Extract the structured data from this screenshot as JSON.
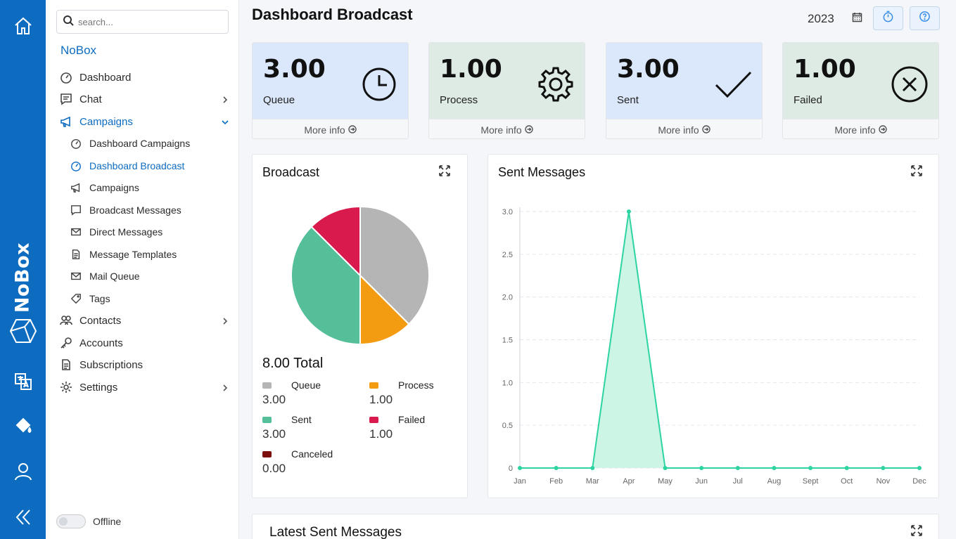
{
  "rail": {
    "brand": "NoBox",
    "icons": [
      "home-icon",
      "nobox-logo-icon",
      "translate-icon",
      "paint-bucket-icon",
      "user-icon",
      "collapse-icon"
    ]
  },
  "sidebar": {
    "search_placeholder": "search...",
    "brand": "NoBox",
    "items": [
      {
        "label": "Dashboard",
        "icon": "gauge-icon"
      },
      {
        "label": "Chat",
        "icon": "chat-icon"
      },
      {
        "label": "Campaigns",
        "icon": "megaphone-icon"
      },
      {
        "label": "Dashboard Campaigns",
        "icon": "gauge-icon"
      },
      {
        "label": "Dashboard Broadcast",
        "icon": "gauge-icon"
      },
      {
        "label": "Campaigns",
        "icon": "megaphone-icon"
      },
      {
        "label": "Broadcast Messages",
        "icon": "message-icon"
      },
      {
        "label": "Direct Messages",
        "icon": "mail-icon"
      },
      {
        "label": "Message Templates",
        "icon": "document-icon"
      },
      {
        "label": "Mail Queue",
        "icon": "mail-icon"
      },
      {
        "label": "Tags",
        "icon": "tag-icon"
      },
      {
        "label": "Contacts",
        "icon": "users-icon"
      },
      {
        "label": "Accounts",
        "icon": "key-icon"
      },
      {
        "label": "Subscriptions",
        "icon": "document-icon"
      },
      {
        "label": "Settings",
        "icon": "gear-icon"
      }
    ],
    "offline_label": "Offline"
  },
  "header": {
    "title": "Dashboard Broadcast",
    "year": "2023"
  },
  "cards": [
    {
      "value": "3.00",
      "label": "Queue",
      "more": "More info",
      "color": "#dbe8fb",
      "icon": "clock-icon"
    },
    {
      "value": "1.00",
      "label": "Process",
      "more": "More info",
      "color": "#deebe4",
      "icon": "gear-icon"
    },
    {
      "value": "3.00",
      "label": "Sent",
      "more": "More info",
      "color": "#dbe8fb",
      "icon": "check-icon"
    },
    {
      "value": "1.00",
      "label": "Failed",
      "more": "More info",
      "color": "#deebe4",
      "icon": "x-circle-icon"
    }
  ],
  "broadcast": {
    "title": "Broadcast",
    "total": "8.00 Total",
    "legend": [
      {
        "name": "Queue",
        "value": "3.00",
        "color": "#b5b5b5"
      },
      {
        "name": "Process",
        "value": "1.00",
        "color": "#f39c12"
      },
      {
        "name": "Sent",
        "value": "3.00",
        "color": "#55bf99"
      },
      {
        "name": "Failed",
        "value": "1.00",
        "color": "#d81b4c"
      },
      {
        "name": "Canceled",
        "value": "0.00",
        "color": "#7b0f0f"
      }
    ]
  },
  "sent_messages": {
    "title": "Sent Messages"
  },
  "latest": {
    "title": "Latest Sent Messages"
  },
  "chart_data": [
    {
      "type": "pie",
      "title": "Broadcast",
      "categories": [
        "Queue",
        "Process",
        "Sent",
        "Failed",
        "Canceled"
      ],
      "values": [
        3,
        1,
        3,
        1,
        0
      ],
      "colors": [
        "#b5b5b5",
        "#f39c12",
        "#55bf99",
        "#d81b4c",
        "#7b0f0f"
      ]
    },
    {
      "type": "area",
      "title": "Sent Messages",
      "categories": [
        "Jan",
        "Feb",
        "Mar",
        "Apr",
        "May",
        "Jun",
        "Jul",
        "Aug",
        "Sept",
        "Oct",
        "Nov",
        "Dec"
      ],
      "values": [
        0,
        0,
        0,
        3,
        0,
        0,
        0,
        0,
        0,
        0,
        0,
        0
      ],
      "yticks": [
        "0",
        "0.5",
        "1.0",
        "1.5",
        "2.0",
        "2.5",
        "3.0"
      ],
      "ylim": [
        0,
        3
      ],
      "grid": true,
      "color": "#2dd4a1"
    }
  ]
}
